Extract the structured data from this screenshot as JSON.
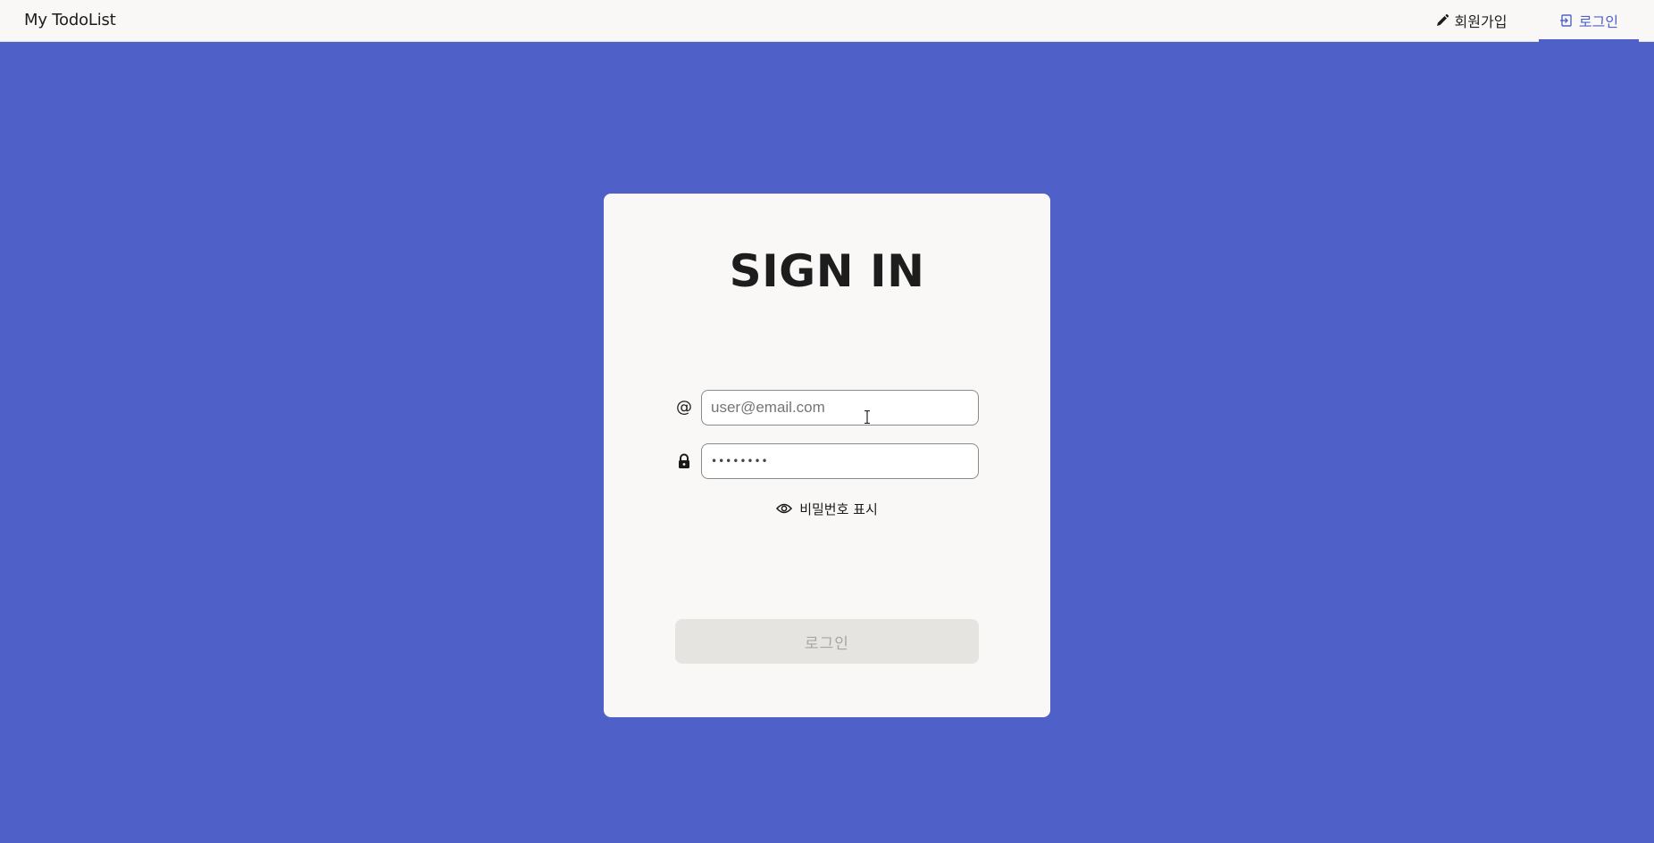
{
  "navbar": {
    "brand": "My TodoList",
    "signup_label": "회원가입",
    "login_label": "로그인",
    "signup_icon": "pencil-icon",
    "login_icon": "login-icon",
    "active_color": "#4f60c9"
  },
  "form": {
    "title": "SIGN IN",
    "email_icon": "at-icon",
    "email_symbol": "@",
    "email_placeholder": "user@email.com",
    "email_value": "",
    "password_icon": "lock-icon",
    "password_masked": "••••••••",
    "show_password_icon": "eye-icon",
    "show_password_label": "비밀번호 표시",
    "submit_label": "로그인",
    "submit_disabled": true
  },
  "colors": {
    "background": "#4f60c9",
    "card": "#f9f8f6",
    "button_disabled_bg": "#e5e4e1",
    "button_disabled_text": "#a6a6a6"
  }
}
